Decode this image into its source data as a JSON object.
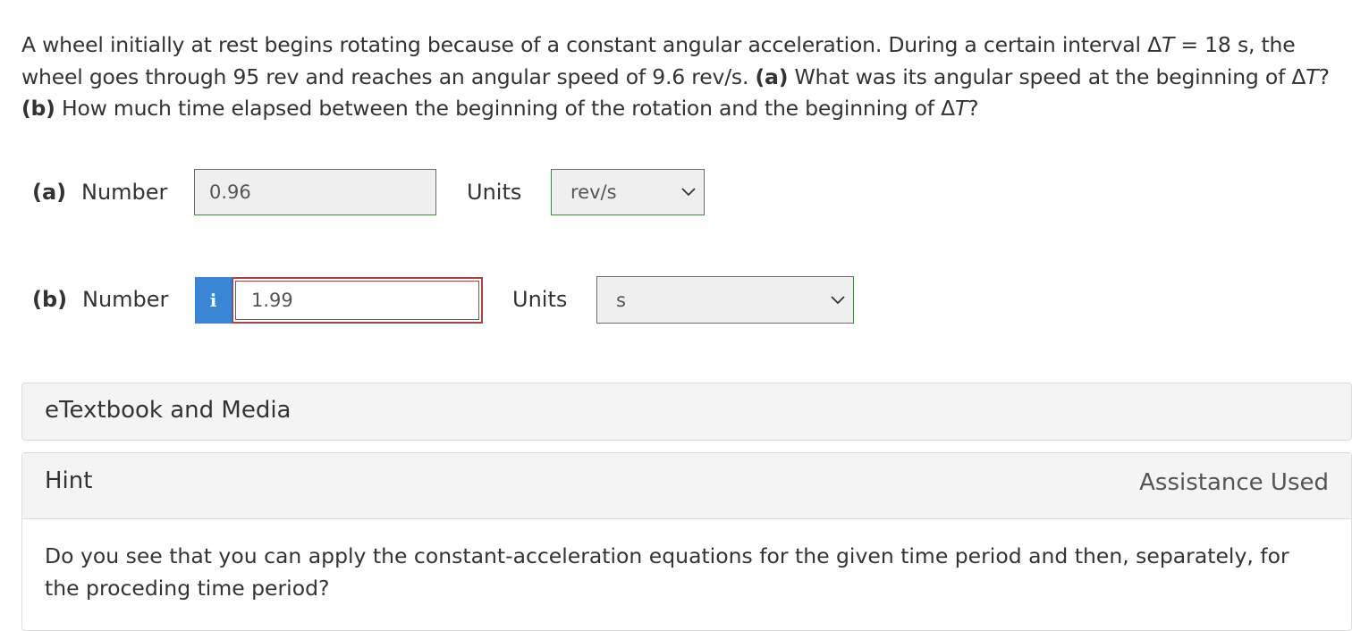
{
  "question": {
    "text_1": "A wheel initially at rest begins rotating because of a constant angular acceleration. During a certain interval Δ",
    "T1": "T",
    "text_2": " = 18 s, the wheel goes through 95 rev and reaches an angular speed of 9.6 rev/s. ",
    "part_a_tag": "(a)",
    "text_3": " What was its angular speed at the beginning of Δ",
    "T2": "T",
    "text_4": "? ",
    "part_b_tag": "(b)",
    "text_5": " How much time elapsed between the beginning of the rotation and the beginning of Δ",
    "T3": "T",
    "text_6": "?"
  },
  "part_a": {
    "tag": "(a)",
    "number_label": "Number",
    "value": "0.96",
    "units_label": "Units",
    "unit": "rev/s"
  },
  "part_b": {
    "tag": "(b)",
    "number_label": "Number",
    "info_icon": "i",
    "value": "1.99",
    "units_label": "Units",
    "unit": "s"
  },
  "etextbook": {
    "title": "eTextbook and Media"
  },
  "hint": {
    "title": "Hint",
    "status": "Assistance Used",
    "body": "Do you see that you can apply the constant-acceleration equations for the given time period and then, separately, for the proceding time period?"
  },
  "colors": {
    "correct_border": "#4f7f4f",
    "incorrect_border": "#a94442",
    "info_button": "#3a86d6"
  }
}
